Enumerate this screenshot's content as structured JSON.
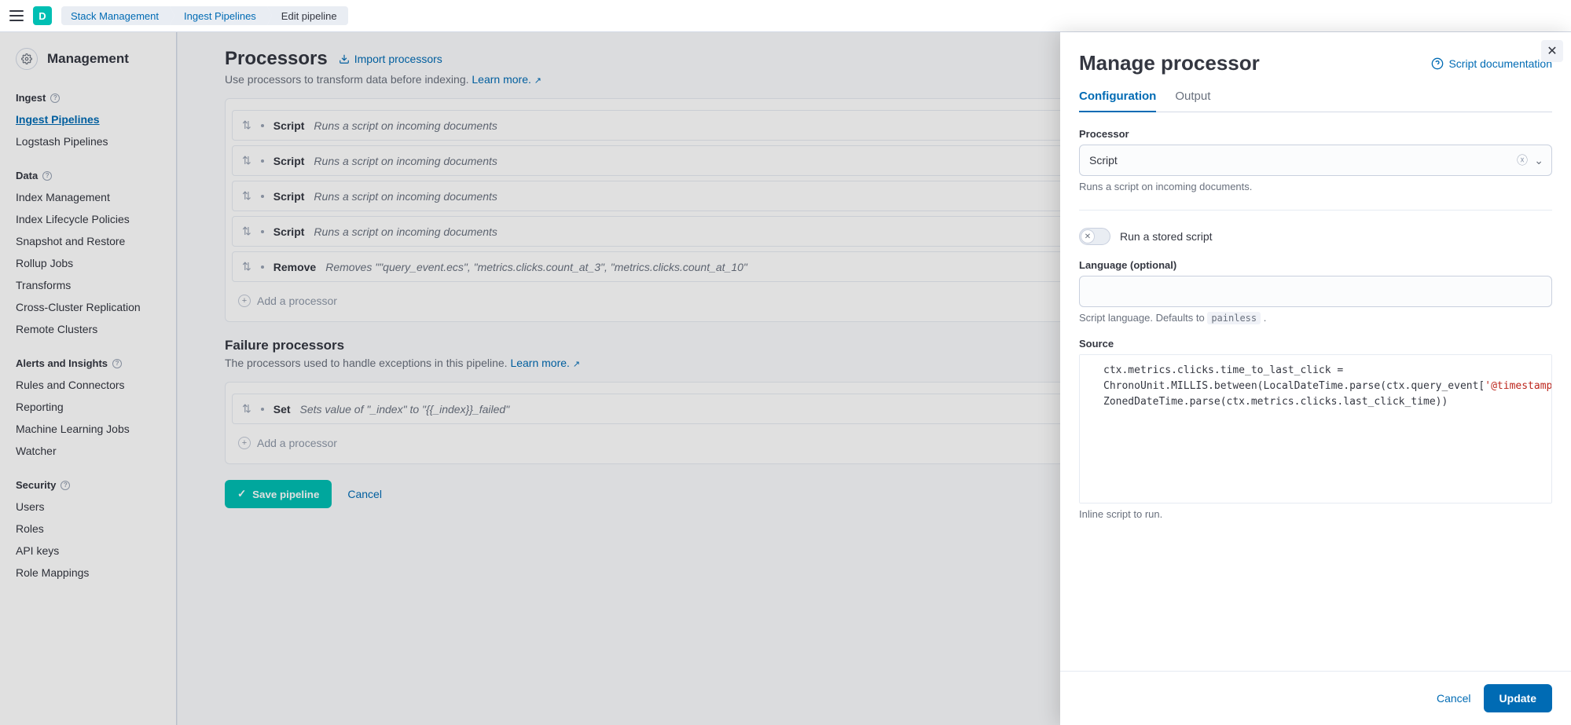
{
  "topbar": {
    "avatar_letter": "D",
    "breadcrumbs": [
      "Stack Management",
      "Ingest Pipelines",
      "Edit pipeline"
    ]
  },
  "sidebar": {
    "header": "Management",
    "sections": [
      {
        "title": "Ingest",
        "items": [
          {
            "label": "Ingest Pipelines",
            "active": true
          },
          {
            "label": "Logstash Pipelines",
            "active": false
          }
        ]
      },
      {
        "title": "Data",
        "items": [
          {
            "label": "Index Management"
          },
          {
            "label": "Index Lifecycle Policies"
          },
          {
            "label": "Snapshot and Restore"
          },
          {
            "label": "Rollup Jobs"
          },
          {
            "label": "Transforms"
          },
          {
            "label": "Cross-Cluster Replication"
          },
          {
            "label": "Remote Clusters"
          }
        ]
      },
      {
        "title": "Alerts and Insights",
        "items": [
          {
            "label": "Rules and Connectors"
          },
          {
            "label": "Reporting"
          },
          {
            "label": "Machine Learning Jobs"
          },
          {
            "label": "Watcher"
          }
        ]
      },
      {
        "title": "Security",
        "items": [
          {
            "label": "Users"
          },
          {
            "label": "Roles"
          },
          {
            "label": "API keys"
          },
          {
            "label": "Role Mappings"
          }
        ]
      }
    ]
  },
  "main": {
    "processors_heading": "Processors",
    "import_label": "Import processors",
    "processors_desc": "Use processors to transform data before indexing. ",
    "learn_more": "Learn more.",
    "processors": [
      {
        "name": "Script",
        "desc": "Runs a script on incoming documents"
      },
      {
        "name": "Script",
        "desc": "Runs a script on incoming documents"
      },
      {
        "name": "Script",
        "desc": "Runs a script on incoming documents"
      },
      {
        "name": "Script",
        "desc": "Runs a script on incoming documents"
      },
      {
        "name": "Remove",
        "desc": "Removes \"\"query_event.ecs\", \"metrics.clicks.count_at_3\", \"metrics.clicks.count_at_10\""
      }
    ],
    "add_processor": "Add a processor",
    "failure_heading": "Failure processors",
    "failure_desc": "The processors used to handle exceptions in this pipeline. ",
    "failure_processors": [
      {
        "name": "Set",
        "desc": "Sets value of \"_index\" to \"{{_index}}_failed\""
      }
    ],
    "save_label": "Save pipeline",
    "cancel_label": "Cancel"
  },
  "flyout": {
    "title": "Manage processor",
    "doc_link": "Script documentation",
    "tabs": {
      "configuration": "Configuration",
      "output": "Output"
    },
    "processor_field": {
      "label": "Processor",
      "value": "Script",
      "help": "Runs a script on incoming documents."
    },
    "stored_script_toggle": {
      "label": "Run a stored script",
      "on": false
    },
    "language_field": {
      "label": "Language (optional)",
      "value": "",
      "help_prefix": "Script language. Defaults to ",
      "help_code": "painless",
      "help_suffix": " ."
    },
    "source_field": {
      "label": "Source",
      "code_pre": "ctx.metrics.clicks.time_to_last_click = ChronoUnit.MILLIS.between(LocalDateTime.parse(ctx.query_event[",
      "code_str": "'@timestamp'",
      "code_post": "]), ZonedDateTime.parse(ctx.metrics.clicks.last_click_time))",
      "help": "Inline script to run."
    },
    "footer": {
      "cancel": "Cancel",
      "update": "Update"
    }
  }
}
